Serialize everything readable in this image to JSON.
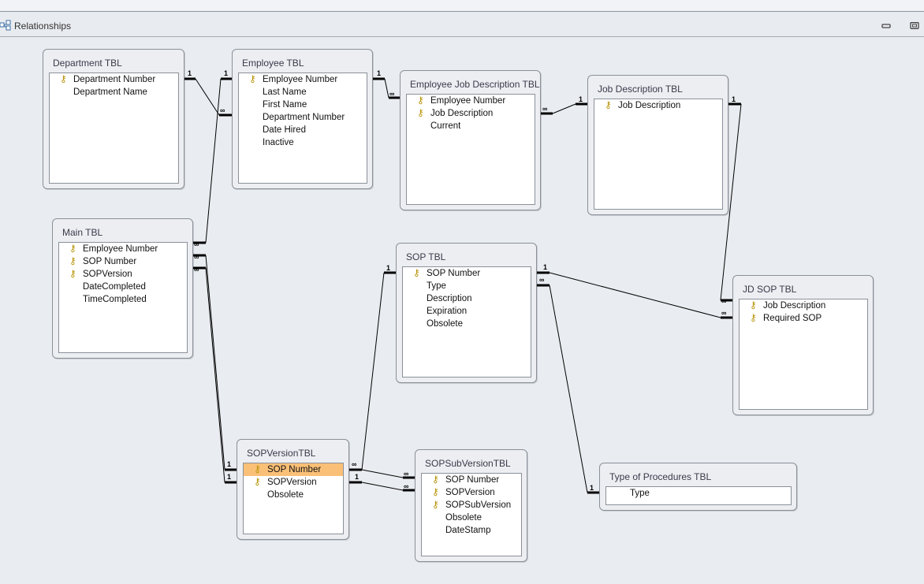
{
  "window": {
    "title": "Relationships",
    "minimize_icon": "minimize-icon",
    "restore_icon": "restore-icon"
  },
  "cardinality": {
    "one": "1",
    "many": "∞"
  },
  "tables": [
    {
      "id": "department-tbl",
      "title": "Department TBL",
      "fields": [
        {
          "name": "Department Number",
          "key": true
        },
        {
          "name": "Department Name",
          "key": false
        }
      ]
    },
    {
      "id": "employee-tbl",
      "title": "Employee TBL",
      "fields": [
        {
          "name": "Employee Number",
          "key": true
        },
        {
          "name": "Last Name",
          "key": false
        },
        {
          "name": "First Name",
          "key": false
        },
        {
          "name": "Department Number",
          "key": false
        },
        {
          "name": "Date Hired",
          "key": false
        },
        {
          "name": "Inactive",
          "key": false
        }
      ]
    },
    {
      "id": "employee-job-description-tbl",
      "title": "Employee Job Description TBL",
      "fields": [
        {
          "name": "Employee Number",
          "key": true
        },
        {
          "name": "Job Description",
          "key": true
        },
        {
          "name": "Current",
          "key": false
        }
      ]
    },
    {
      "id": "job-description-tbl",
      "title": "Job Description TBL",
      "fields": [
        {
          "name": "Job Description",
          "key": true
        }
      ]
    },
    {
      "id": "main-tbl",
      "title": "Main TBL",
      "fields": [
        {
          "name": "Employee Number",
          "key": true
        },
        {
          "name": "SOP Number",
          "key": true
        },
        {
          "name": "SOPVersion",
          "key": true
        },
        {
          "name": "DateCompleted",
          "key": false
        },
        {
          "name": "TimeCompleted",
          "key": false
        }
      ]
    },
    {
      "id": "sop-tbl",
      "title": "SOP TBL",
      "fields": [
        {
          "name": "SOP Number",
          "key": true
        },
        {
          "name": "Type",
          "key": false
        },
        {
          "name": "Description",
          "key": false
        },
        {
          "name": "Expiration",
          "key": false
        },
        {
          "name": "Obsolete",
          "key": false
        }
      ]
    },
    {
      "id": "jd-sop-tbl",
      "title": "JD SOP TBL",
      "fields": [
        {
          "name": "Job Description",
          "key": true
        },
        {
          "name": "Required SOP",
          "key": true
        }
      ]
    },
    {
      "id": "sopversion-tbl",
      "title": "SOPVersionTBL",
      "fields": [
        {
          "name": "SOP Number",
          "key": true,
          "selected": true
        },
        {
          "name": "SOPVersion",
          "key": true
        },
        {
          "name": "Obsolete",
          "key": false
        }
      ]
    },
    {
      "id": "sopsubversion-tbl",
      "title": "SOPSubVersionTBL",
      "fields": [
        {
          "name": "SOP Number",
          "key": true
        },
        {
          "name": "SOPVersion",
          "key": true
        },
        {
          "name": "SOPSubVersion",
          "key": true
        },
        {
          "name": "Obsolete",
          "key": false
        },
        {
          "name": "DateStamp",
          "key": false
        }
      ]
    },
    {
      "id": "type-of-procedures-tbl",
      "title": "Type of Procedures TBL",
      "fields": [
        {
          "name": "Type",
          "key": false
        }
      ]
    }
  ]
}
